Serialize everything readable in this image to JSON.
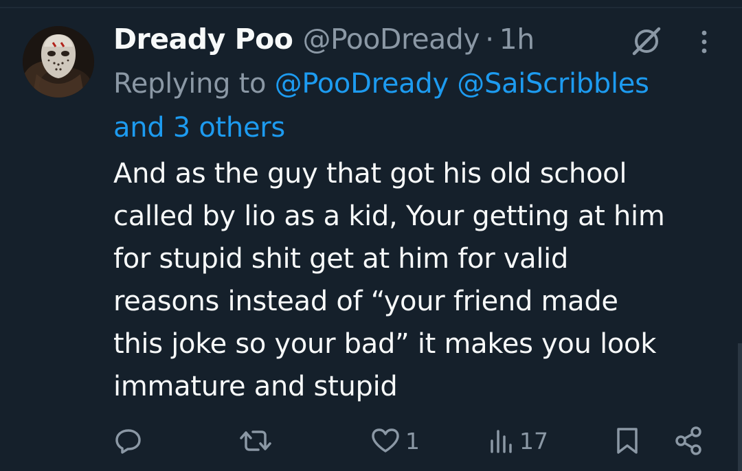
{
  "tweet": {
    "display_name": "Dready Poo",
    "handle": "@PooDready",
    "separator": "·",
    "time": "1h",
    "reply_prefix": "Replying to ",
    "mention_1": "@PooDready",
    "mention_2": "@SaiScribbles",
    "mention_others": "and 3 others",
    "body": "And as the guy that got his old school\ncalled by lio as a kid, Your getting at him\nfor stupid shit get at him for valid\nreasons instead of “your friend made\nthis joke so your bad” it makes you look\nimmature and stupid"
  },
  "actions": {
    "reply_icon": "reply-icon",
    "repost_icon": "repost-icon",
    "like_icon": "heart-icon",
    "like_count": "1",
    "views_icon": "views-icon",
    "views_count": "17",
    "bookmark_icon": "bookmark-icon",
    "share_icon": "share-icon"
  },
  "header_icons": {
    "grok": "grok-icon",
    "more": "more-icon"
  },
  "colors": {
    "background": "#15202b",
    "text_primary": "#f7f9f9",
    "text_secondary": "#8b98a5",
    "link": "#1d9bf0"
  }
}
